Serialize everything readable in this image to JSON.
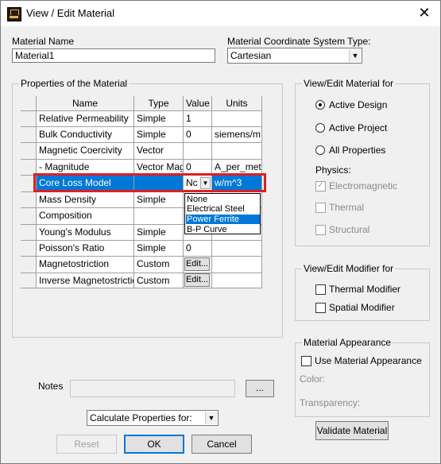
{
  "window": {
    "title": "View / Edit Material",
    "close_glyph": "✕"
  },
  "material_name": {
    "label": "Material Name",
    "value": "Material1"
  },
  "coord_system": {
    "label": "Material Coordinate System Type:",
    "value": "Cartesian"
  },
  "properties": {
    "group_title": "Properties of the Material",
    "headers": [
      "Name",
      "Type",
      "Value",
      "Units"
    ],
    "rows": [
      {
        "name": "Relative Permeability",
        "type": "Simple",
        "value": "1",
        "units": ""
      },
      {
        "name": "Bulk Conductivity",
        "type": "Simple",
        "value": "0",
        "units": "siemens/m"
      },
      {
        "name": "Magnetic Coercivity",
        "type": "Vector",
        "value": "",
        "units": ""
      },
      {
        "name": "- Magnitude",
        "type": "Vector Mag",
        "value": "0",
        "units": "A_per_meter"
      },
      {
        "name": "Core Loss Model",
        "type": "",
        "value": "Nc",
        "units": "w/m^3"
      },
      {
        "name": "Mass Density",
        "type": "Simple",
        "value": "",
        "units": ""
      },
      {
        "name": "Composition",
        "type": "",
        "value": "",
        "units": ""
      },
      {
        "name": "Young's Modulus",
        "type": "Simple",
        "value": "",
        "units": ""
      },
      {
        "name": "Poisson's Ratio",
        "type": "Simple",
        "value": "0",
        "units": ""
      },
      {
        "name": "Magnetostriction",
        "type": "Custom",
        "value": "Edit...",
        "units": ""
      },
      {
        "name": "Inverse Magnetostriction",
        "type": "Custom",
        "value": "Edit...",
        "units": ""
      }
    ],
    "dropdown_options": [
      "None",
      "Electrical Steel",
      "Power Ferrite",
      "B-P Curve"
    ],
    "dropdown_selected": "Power Ferrite"
  },
  "view_edit_for": {
    "title": "View/Edit Material for",
    "options": [
      "Active Design",
      "Active Project",
      "All Properties"
    ],
    "selected": "Active Design",
    "physics_label": "Physics:",
    "physics": [
      {
        "label": "Electromagnetic",
        "checked": true
      },
      {
        "label": "Thermal",
        "checked": false
      },
      {
        "label": "Structural",
        "checked": false
      }
    ]
  },
  "modifier": {
    "title": "View/Edit Modifier for",
    "items": [
      "Thermal Modifier",
      "Spatial Modifier"
    ]
  },
  "appearance": {
    "title": "Material Appearance",
    "use_label": "Use Material Appearance",
    "color_label": "Color:",
    "transparency_label": "Transparency:"
  },
  "notes": {
    "label": "Notes",
    "browse_label": "..."
  },
  "calc_props": {
    "value": "Calculate Properties for:"
  },
  "buttons": {
    "validate": "Validate Material",
    "reset": "Reset",
    "ok": "OK",
    "cancel": "Cancel"
  },
  "colors": {
    "selection": "#0078d7",
    "highlight": "#e02020"
  }
}
